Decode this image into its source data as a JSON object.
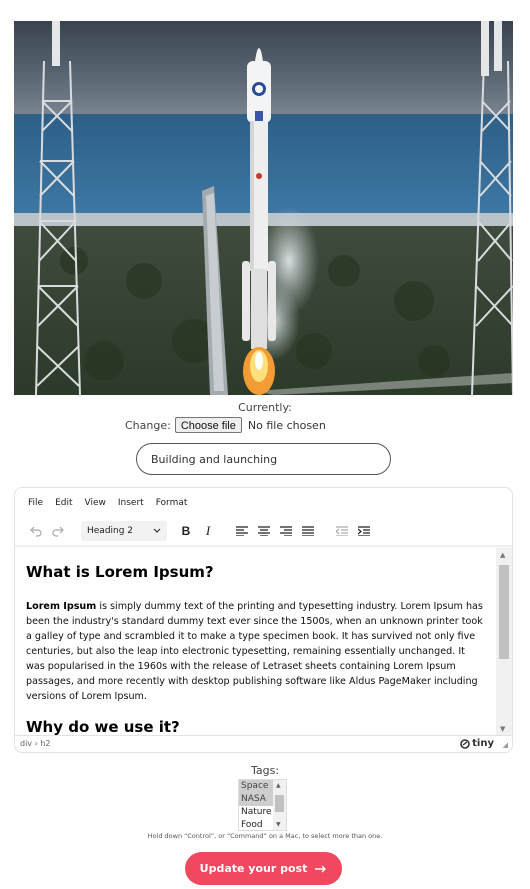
{
  "image": {
    "subject": "rocket-launch"
  },
  "file_upload": {
    "currently_label": "Currently:",
    "change_label": "Change:",
    "button_label": "Choose file",
    "status": "No file chosen"
  },
  "title_field": {
    "value": "Building and launching"
  },
  "editor": {
    "menu": [
      "File",
      "Edit",
      "View",
      "Insert",
      "Format"
    ],
    "block_format": "Heading 2",
    "heading1": "What is Lorem Ipsum?",
    "para_lead": "Lorem Ipsum",
    "para_rest": " is simply dummy text of the printing and typesetting industry. Lorem Ipsum has been the industry's standard dummy text ever since the 1500s, when an unknown printer took a galley of type and scrambled it to make a type specimen book. It has survived not only five centuries, but also the leap into electronic typesetting, remaining essentially unchanged. It was popularised in the 1960s with the release of Letraset sheets containing Lorem Ipsum passages, and more recently with desktop publishing software like Aldus PageMaker including versions of Lorem Ipsum.",
    "heading2": "Why do we use it?",
    "status_path": "div › h2",
    "brand": "tiny"
  },
  "tags": {
    "label": "Tags:",
    "options": [
      {
        "label": "Space",
        "selected": true
      },
      {
        "label": "NASA",
        "selected": true
      },
      {
        "label": "Nature",
        "selected": false
      },
      {
        "label": "Food",
        "selected": false
      }
    ],
    "help": "Hold down “Control”, or “Command” on a Mac, to select more than one."
  },
  "submit": {
    "label": "Update your post",
    "color": "#f0485e"
  }
}
